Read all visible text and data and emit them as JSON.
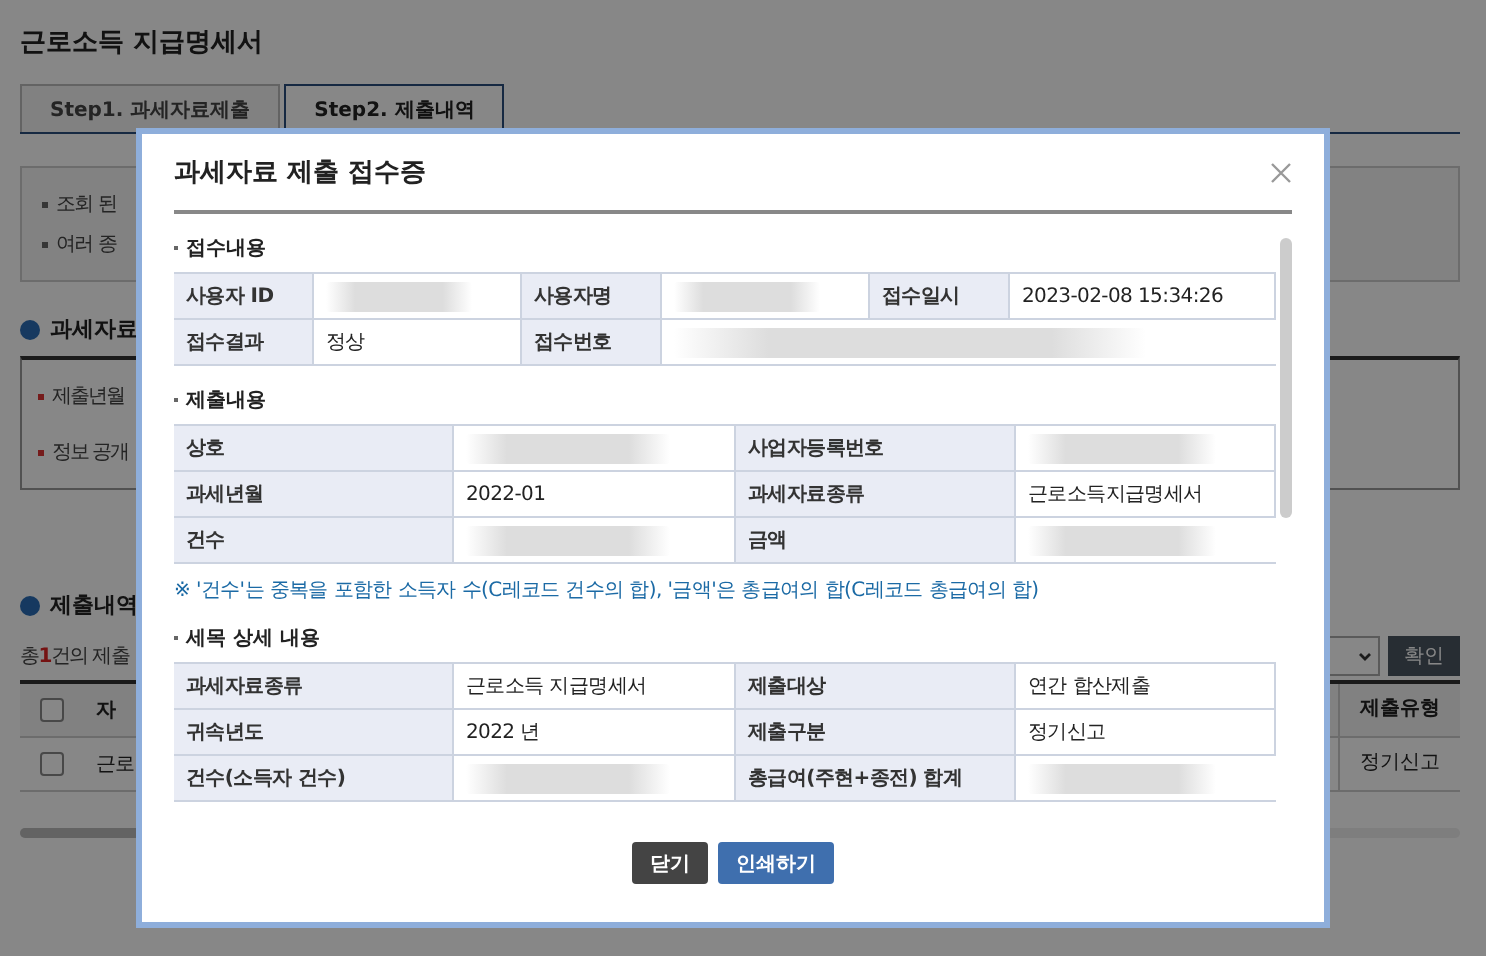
{
  "page": {
    "title": "근로소득 지급명세서",
    "tabs": [
      {
        "label": "Step1. 과세자료제출",
        "selected": false
      },
      {
        "label": "Step2. 제출내역",
        "selected": true
      }
    ],
    "notices": [
      "조회 된",
      "여러 종"
    ],
    "section_1": {
      "title": "과세자료",
      "items": [
        "제출년월",
        "정보 공개"
      ]
    },
    "section_2": {
      "title": "제출내역",
      "summary": "총**1**건의 제출",
      "confirm_button": "확인",
      "table": {
        "header_checked": false,
        "columns": [
          "자",
          "제출유형"
        ],
        "rows": [
          {
            "selected": false,
            "cells": [
              "근로",
              "정기신고"
            ]
          }
        ]
      }
    }
  },
  "modal": {
    "title": "과세자료 제출 접수증",
    "sections": [
      {
        "title": "접수내용",
        "rows": [
          [
            {
              "kind": "label",
              "text": "사용자 ID"
            },
            {
              "kind": "redacted"
            },
            {
              "kind": "label",
              "text": "사용자명"
            },
            {
              "kind": "redacted"
            },
            {
              "kind": "label",
              "text": "접수일시"
            },
            {
              "kind": "value",
              "text": "2023-02-08 15:34:26"
            }
          ],
          [
            {
              "kind": "label",
              "text": "접수결과"
            },
            {
              "kind": "value",
              "text": "정상"
            },
            {
              "kind": "label",
              "text": "접수번호"
            },
            {
              "kind": "redacted"
            }
          ]
        ]
      },
      {
        "title": "제출내용",
        "rows": [
          [
            {
              "kind": "label",
              "text": "상호"
            },
            {
              "kind": "redacted"
            },
            {
              "kind": "label",
              "text": "사업자등록번호"
            },
            {
              "kind": "redacted"
            }
          ],
          [
            {
              "kind": "label",
              "text": "과세년월"
            },
            {
              "kind": "value",
              "text": "2022-01"
            },
            {
              "kind": "label",
              "text": "과세자료종류"
            },
            {
              "kind": "value",
              "text": "근로소득지급명세서"
            }
          ],
          [
            {
              "kind": "label",
              "text": "건수"
            },
            {
              "kind": "redacted"
            },
            {
              "kind": "label",
              "text": "금액"
            },
            {
              "kind": "redacted"
            }
          ]
        ],
        "note": "※ '건수'는 중복을 포함한 소득자 수(C레코드 건수의 합), '금액'은 총급여의 합(C레코드 총급여의 합)"
      },
      {
        "title": "세목 상세 내용",
        "rows": [
          [
            {
              "kind": "label",
              "text": "과세자료종류"
            },
            {
              "kind": "value",
              "text": "근로소득 지급명세서"
            },
            {
              "kind": "label",
              "text": "제출대상"
            },
            {
              "kind": "value",
              "text": "연간 합산제출"
            }
          ],
          [
            {
              "kind": "label",
              "text": "귀속년도"
            },
            {
              "kind": "value",
              "text": "2022 년"
            },
            {
              "kind": "label",
              "text": "제출구분"
            },
            {
              "kind": "value",
              "text": "정기신고"
            }
          ],
          [
            {
              "kind": "label",
              "text": "건수(소득자 건수)"
            },
            {
              "kind": "redacted"
            },
            {
              "kind": "label",
              "text": "총급여(주현+종전) 합계"
            },
            {
              "kind": "redacted"
            }
          ]
        ]
      }
    ],
    "buttons": [
      {
        "label": "닫기",
        "kind": "dark"
      },
      {
        "label": "인쇄하기",
        "kind": "primary"
      }
    ]
  }
}
